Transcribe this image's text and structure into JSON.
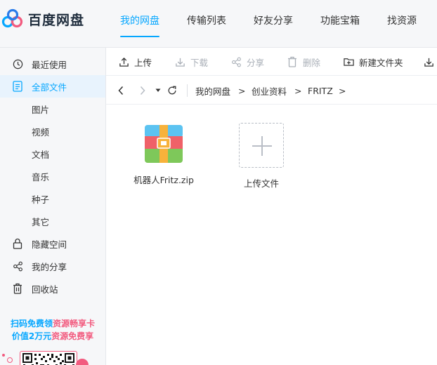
{
  "app": {
    "name": "百度网盘"
  },
  "nav": {
    "tabs": [
      "我的网盘",
      "传输列表",
      "好友分享",
      "功能宝箱",
      "找资源"
    ]
  },
  "sidebar": {
    "recent": "最近使用",
    "all_files": "全部文件",
    "categories": [
      "图片",
      "视频",
      "文档",
      "音乐",
      "种子",
      "其它"
    ],
    "hidden_space": "隐藏空间",
    "my_share": "我的分享",
    "recycle_bin": "回收站"
  },
  "promo": {
    "line1_a": "扫码免费领",
    "line1_b": "资源畅享卡",
    "line2_a": "价值2万元",
    "line2_b": "资源免费享"
  },
  "toolbar": {
    "upload": "上传",
    "download": "下载",
    "share": "分享",
    "delete": "删除",
    "new_folder": "新建文件夹"
  },
  "path": {
    "sep": ">",
    "crumbs": [
      "我的网盘",
      "创业资料",
      "FRITZ"
    ]
  },
  "files": [
    {
      "name": "机器人Fritz.zip",
      "icon": "zip-archive-icon"
    }
  ],
  "upload_tile": {
    "label": "上传文件"
  },
  "colors": {
    "accent": "#06a7ff",
    "promo_pink": "#f25b7f"
  }
}
